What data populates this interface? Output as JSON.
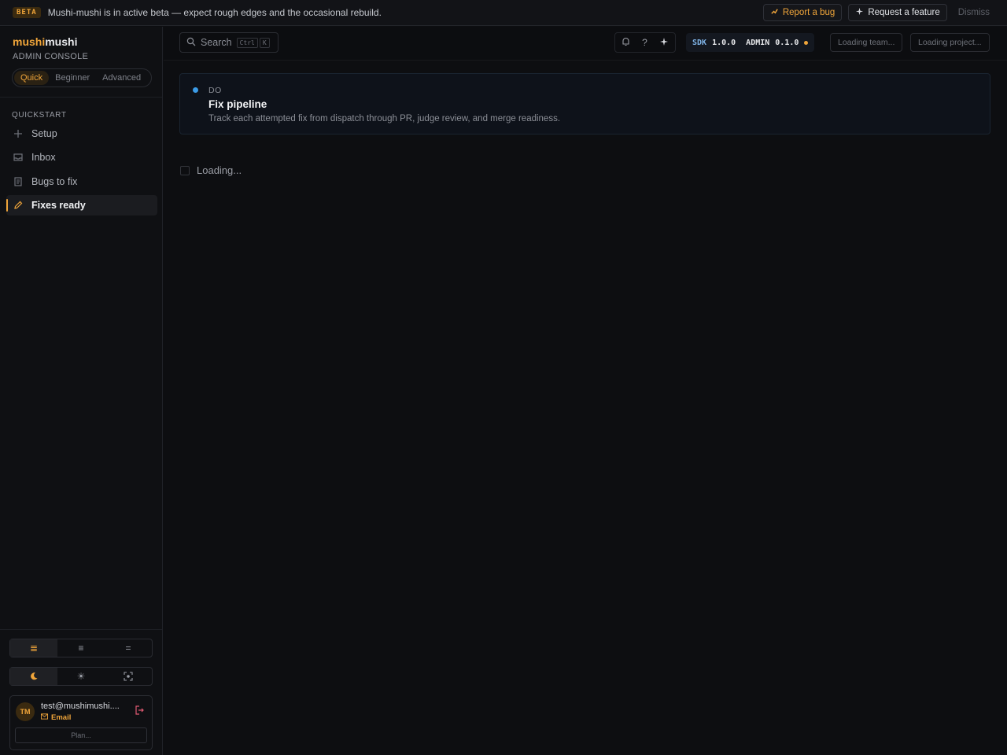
{
  "banner": {
    "badge": "BETA",
    "message": "Mushi-mushi is in active beta — expect rough edges and the occasional rebuild.",
    "report_bug": "Report a bug",
    "request_feature": "Request a feature",
    "dismiss": "Dismiss"
  },
  "sidebar": {
    "brand_part1": "mushi",
    "brand_part2": "mushi",
    "subtitle": "ADMIN CONSOLE",
    "modes": [
      "Quick",
      "Beginner",
      "Advanced"
    ],
    "active_mode": "Quick",
    "section": "QUICKSTART",
    "items": [
      {
        "label": "Setup",
        "icon": "plus-icon"
      },
      {
        "label": "Inbox",
        "icon": "inbox-icon"
      },
      {
        "label": "Bugs to fix",
        "icon": "document-icon"
      },
      {
        "label": "Fixes ready",
        "icon": "pencil-icon",
        "active": true
      }
    ],
    "density_active": "comfortable",
    "theme_active": "dark",
    "user": {
      "initials": "TM",
      "email": "test@mushimushi....",
      "method": "Email",
      "plan": "Plan..."
    }
  },
  "topbar": {
    "search_label": "Search",
    "kbd_ctrl": "Ctrl",
    "kbd_k": "K",
    "help": "?",
    "sdk_label": "SDK",
    "sdk_version": "1.0.0",
    "admin_label": "ADMIN",
    "admin_version": "0.1.0",
    "team": "Loading team...",
    "project": "Loading project..."
  },
  "header": {
    "stage": "DO",
    "title": "Fix pipeline",
    "description": "Track each attempted fix from dispatch through PR, judge review, and merge readiness."
  },
  "main": {
    "loading": "Loading..."
  },
  "colors": {
    "accent": "#f0a53a",
    "info": "#3b9be6",
    "background": "#0d0e11"
  }
}
